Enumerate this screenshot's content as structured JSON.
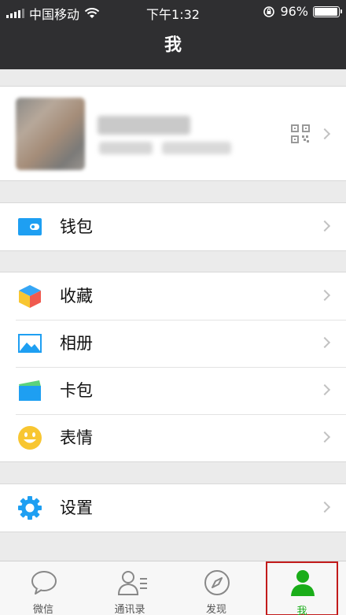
{
  "status_bar": {
    "carrier": "中国移动",
    "time": "下午1:32",
    "battery": "96%",
    "battery_level": 0.96,
    "icons": [
      "signal-icon",
      "wifi-icon",
      "rotation-lock-icon",
      "battery-icon"
    ]
  },
  "nav": {
    "title": "我"
  },
  "profile": {
    "icons": [
      "avatar",
      "qr-code-icon",
      "chevron-right-icon"
    ]
  },
  "menu": {
    "wallet": "钱包",
    "favorites": "收藏",
    "album": "相册",
    "cards": "卡包",
    "stickers": "表情",
    "settings": "设置"
  },
  "colors": {
    "header_bg": "#2f2f31",
    "page_bg": "#ebebeb",
    "accent_green": "#1aad19",
    "icon_blue": "#1e9ff2",
    "highlight_red": "#c21b1b"
  },
  "tabs": [
    {
      "label": "微信",
      "icon": "chat-bubble-icon",
      "active": false
    },
    {
      "label": "通讯录",
      "icon": "contacts-icon",
      "active": false
    },
    {
      "label": "发现",
      "icon": "compass-icon",
      "active": false
    },
    {
      "label": "我",
      "icon": "me-person-icon",
      "active": true
    }
  ]
}
